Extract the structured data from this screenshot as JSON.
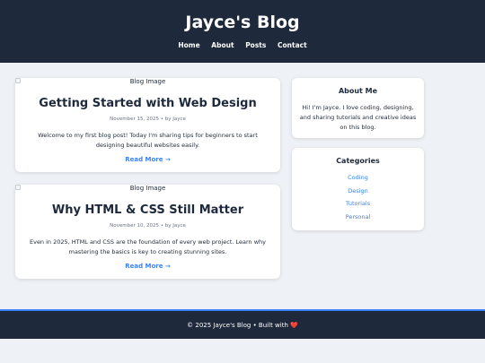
{
  "header": {
    "title": "Jayce's Blog",
    "nav": [
      "Home",
      "About",
      "Posts",
      "Contact"
    ]
  },
  "posts": [
    {
      "image_alt": "Blog Image",
      "title": "Getting Started with Web Design",
      "meta": "November 15, 2025 • by Jayce",
      "excerpt": "Welcome to my first blog post! Today I'm sharing tips for beginners to start designing beautiful websites easily.",
      "read_more": "Read More →"
    },
    {
      "image_alt": "Blog Image",
      "title": "Why HTML & CSS Still Matter",
      "meta": "November 10, 2025 • by Jayce",
      "excerpt": "Even in 2025, HTML and CSS are the foundation of every web project. Learn why mastering the basics is key to creating stunning sites.",
      "read_more": "Read More →"
    }
  ],
  "sidebar": {
    "about": {
      "title": "About Me",
      "text": "Hi! I'm Jayce. I love coding, designing, and sharing tutorials and creative ideas on this blog."
    },
    "categories": {
      "title": "Categories",
      "items": [
        "Coding",
        "Design",
        "Tutorials",
        "Personal"
      ]
    }
  },
  "footer": {
    "text": "© 2025 Jayce's Blog • Built with ❤️"
  },
  "colors": {
    "header_bg": "#1e293b",
    "page_bg": "#eef1f5",
    "accent": "#3b82f6"
  }
}
